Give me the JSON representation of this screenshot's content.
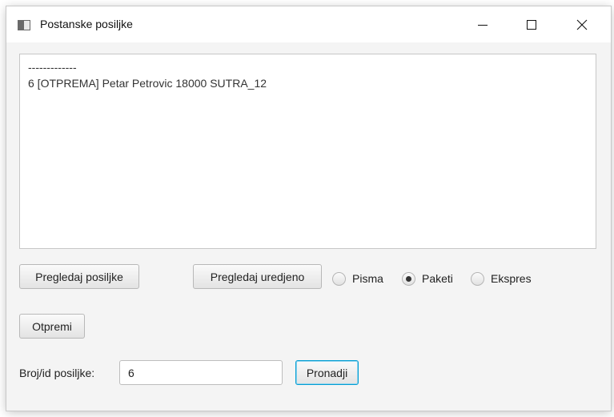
{
  "window": {
    "title": "Postanske posiljke"
  },
  "output": {
    "lines": [
      "-------------",
      "6 [OTPREMA] Petar Petrovic 18000 SUTRA_12"
    ]
  },
  "buttons": {
    "pregledaj_posiljke": "Pregledaj posiljke",
    "pregledaj_uredjeno": "Pregledaj uredjeno",
    "otpremi": "Otpremi",
    "pronadji": "Pronadji"
  },
  "filter": {
    "options": [
      "Pisma",
      "Paketi",
      "Ekspres"
    ],
    "selected": "Paketi"
  },
  "search": {
    "label": "Broj/id posiljke:",
    "value": "6"
  },
  "icons": {
    "app": "app-window-icon",
    "minimize": "minimize-icon",
    "maximize": "maximize-icon",
    "close": "close-icon"
  },
  "colors": {
    "focus_border": "#039ed3",
    "window_bg": "#f4f4f4"
  }
}
